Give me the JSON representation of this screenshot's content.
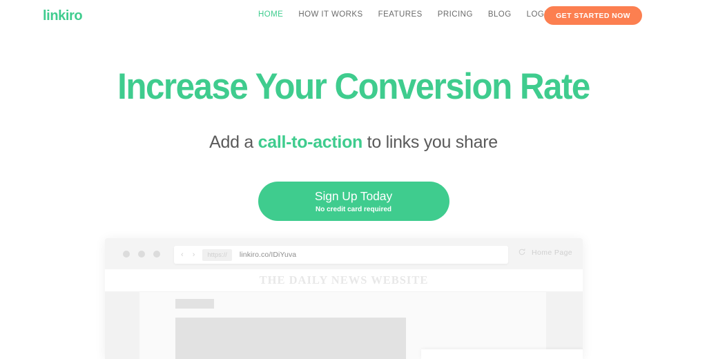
{
  "brand": {
    "logo": "linkiro",
    "green": "#3FCC8E",
    "orange": "#FC7F50"
  },
  "nav": {
    "links": [
      {
        "label": "HOME",
        "active": true
      },
      {
        "label": "HOW IT WORKS",
        "active": false
      },
      {
        "label": "FEATURES",
        "active": false
      },
      {
        "label": "PRICING",
        "active": false
      },
      {
        "label": "BLOG",
        "active": false
      },
      {
        "label": "LOGIN",
        "active": false
      }
    ],
    "cta_label": "GET STARTED NOW"
  },
  "hero": {
    "headline": "Increase Your Conversion Rate",
    "subhead_before": "Add a ",
    "subhead_accent": "call-to-action",
    "subhead_after": " to links you share",
    "signup_label": "Sign Up Today",
    "signup_note": "No credit card required"
  },
  "mockup": {
    "nav_arrows": "‹ ›",
    "https_badge": "https://",
    "url": "linkiro.co/IDiYuva",
    "reload_icon": "reload-icon",
    "page_label": "Home Page",
    "news_title": "THE DAILY NEWS WEBSITE"
  }
}
